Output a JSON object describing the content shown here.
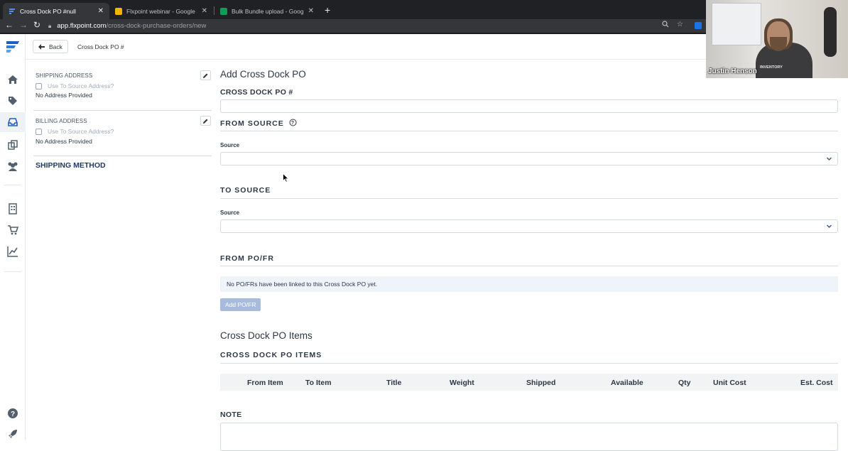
{
  "browser": {
    "tabs": [
      {
        "title": "Cross Dock PO #null",
        "icon": "flxpoint-favicon",
        "active": true
      },
      {
        "title": "Flxpoint webinar - Google Slide",
        "icon": "slides-favicon",
        "active": false
      },
      {
        "title": "Bulk Bundle upload - Google S",
        "icon": "sheets-favicon",
        "active": false
      }
    ],
    "url_domain": "app.flxpoint.com",
    "url_path": "/cross-dock-purchase-orders/new"
  },
  "topbar": {
    "back_label": "Back",
    "breadcrumb": "Cross Dock PO #"
  },
  "left_panel": {
    "shipping_address": {
      "label": "SHIPPING ADDRESS",
      "checkbox_label": "Use To Source Address?",
      "value": "No Address Provided"
    },
    "billing_address": {
      "label": "BILLING ADDRESS",
      "checkbox_label": "Use To Source Address?",
      "value": "No Address Provided"
    },
    "shipping_method_label": "SHIPPING METHOD"
  },
  "form": {
    "title": "Add Cross Dock PO",
    "po_number_heading": "CROSS DOCK PO #",
    "po_number_value": "",
    "from_source_heading": "FROM SOURCE",
    "from_source_field_label": "Source",
    "to_source_heading": "TO SOURCE",
    "to_source_field_label": "Source",
    "from_pofr_heading": "FROM PO/FR",
    "pofr_empty_message": "No PO/FRs have been linked to this Cross Dock PO yet.",
    "add_pofr_label": "Add PO/FR",
    "items_title": "Cross Dock PO Items",
    "items_heading": "CROSS DOCK PO ITEMS",
    "items_columns": [
      "From Item",
      "To Item",
      "Title",
      "Weight",
      "Shipped",
      "Available",
      "Qty",
      "Unit Cost",
      "Est. Cost"
    ],
    "note_heading": "NOTE"
  },
  "webcam": {
    "presenter_name": "Justin Henson",
    "shirt_logo": "INVENTORY"
  },
  "colors": {
    "brand": "#1f5fbf",
    "add_button": "#a9bbdc",
    "info_bg": "#eef4fa"
  }
}
